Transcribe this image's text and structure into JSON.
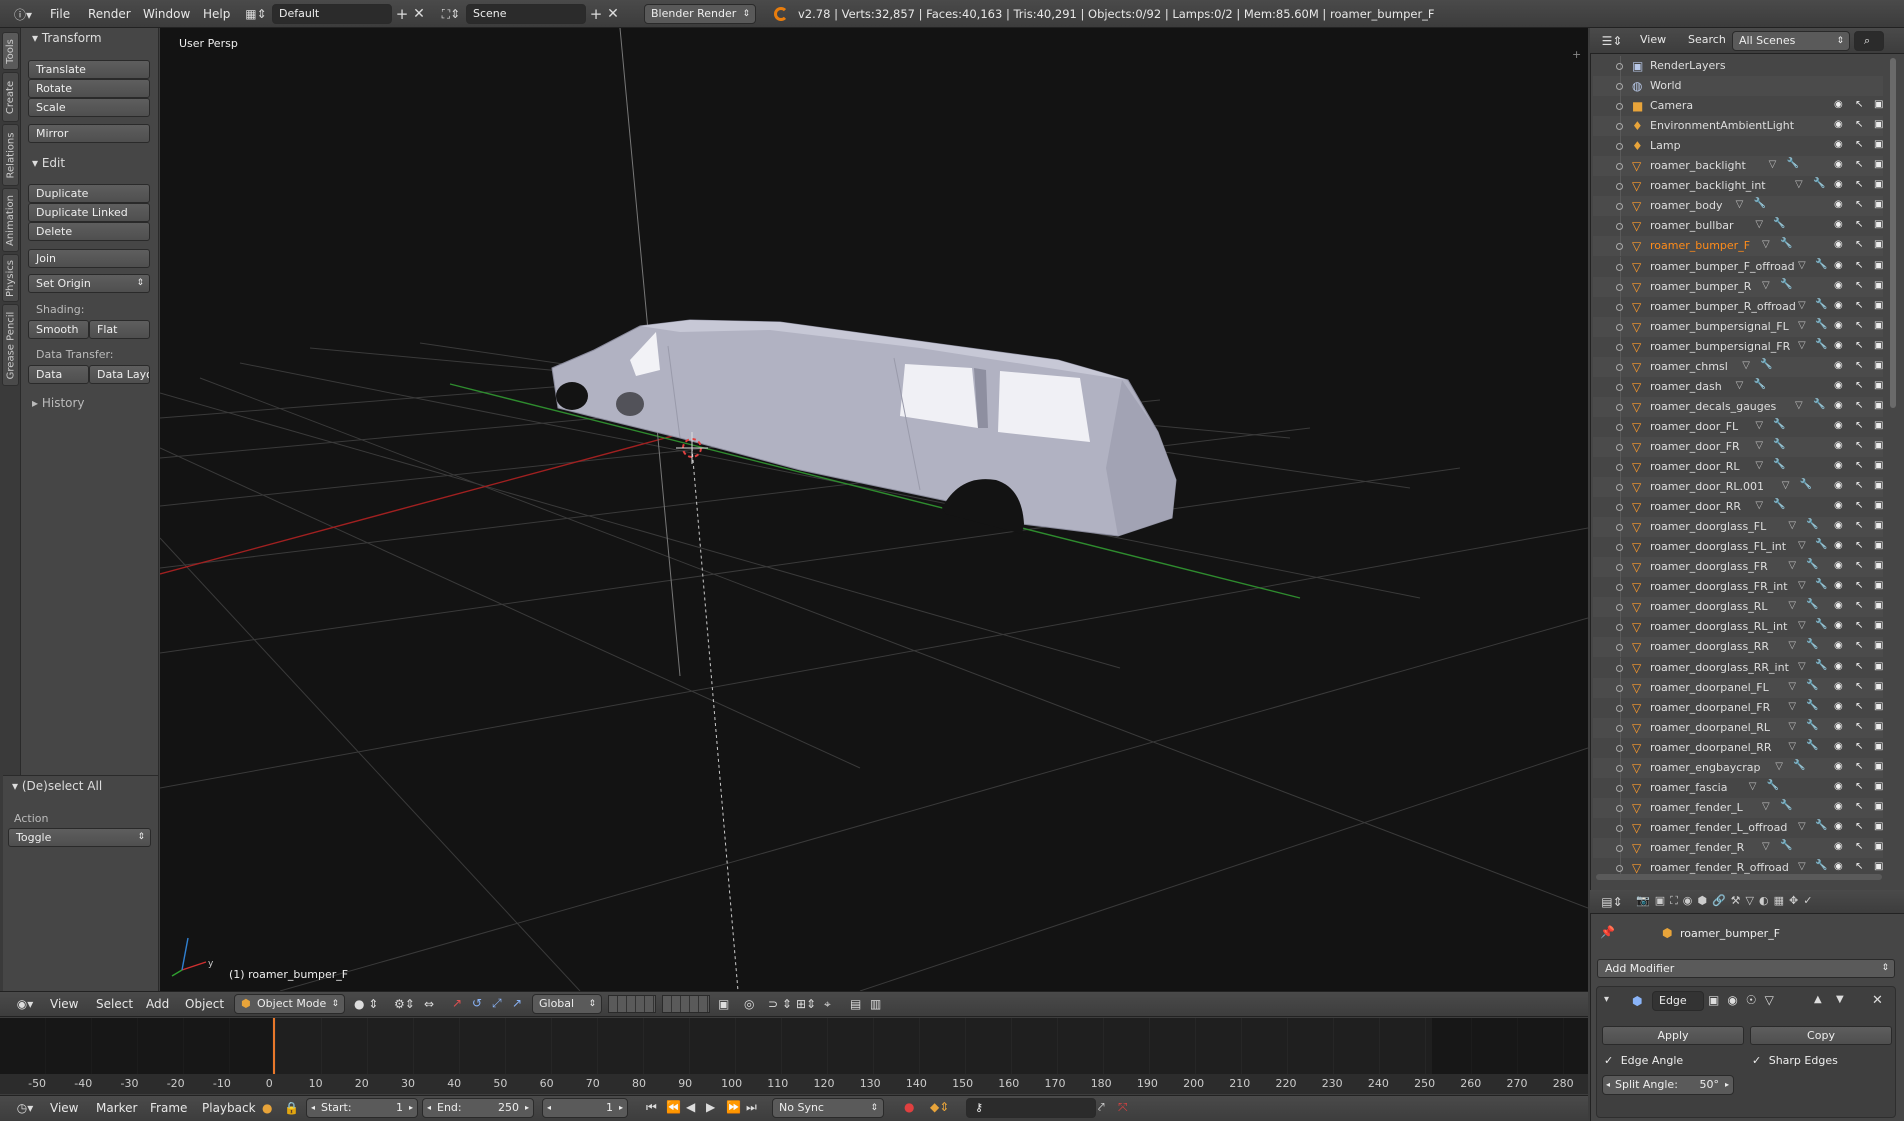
{
  "topbar": {
    "menus": [
      "File",
      "Render",
      "Window",
      "Help"
    ],
    "layout": "Default",
    "scene": "Scene",
    "engine": "Blender Render",
    "stats": "v2.78 | Verts:32,857 | Faces:40,163 | Tris:40,291 | Objects:0/92 | Lamps:0/2 | Mem:85.60M | roamer_bumper_F"
  },
  "vtabs": [
    "Tools",
    "Create",
    "Relations",
    "Animation",
    "Physics",
    "Grease Pencil"
  ],
  "tool_shelf": {
    "transform_title": "Transform",
    "translate": "Translate",
    "rotate": "Rotate",
    "scale": "Scale",
    "mirror": "Mirror",
    "edit_title": "Edit",
    "duplicate": "Duplicate",
    "duplicate_linked": "Duplicate Linked",
    "delete": "Delete",
    "join": "Join",
    "set_origin": "Set Origin",
    "shading_label": "Shading:",
    "smooth": "Smooth",
    "flat": "Flat",
    "data_transfer_label": "Data Transfer:",
    "data": "Data",
    "data_layout": "Data Layo",
    "history_title": "History",
    "operator_title": "(De)select All",
    "action_label": "Action",
    "action_value": "Toggle"
  },
  "viewport": {
    "view_label": "User Persp",
    "object_label": "(1) roamer_bumper_F"
  },
  "view3d_header": {
    "menus": [
      "View",
      "Select",
      "Add",
      "Object"
    ],
    "mode": "Object Mode",
    "orientation": "Global"
  },
  "timeline": {
    "ruler": [
      "-50",
      "-40",
      "-30",
      "-20",
      "-10",
      "0",
      "10",
      "20",
      "30",
      "40",
      "50",
      "60",
      "70",
      "80",
      "90",
      "100",
      "110",
      "120",
      "130",
      "140",
      "150",
      "160",
      "170",
      "180",
      "190",
      "200",
      "210",
      "220",
      "230",
      "240",
      "250",
      "260",
      "270",
      "280"
    ],
    "current_frame_marker": 0,
    "menus": [
      "View",
      "Marker",
      "Frame",
      "Playback"
    ],
    "start_label": "Start:",
    "start": "1",
    "end_label": "End:",
    "end": "250",
    "current": "1",
    "sync": "No Sync"
  },
  "outliner": {
    "header_menus": [
      "View",
      "Search"
    ],
    "scene_filter": "All Scenes",
    "rows": [
      {
        "name": "RenderLayers",
        "icon": "renderlayers-icon"
      },
      {
        "name": "World",
        "icon": "world-icon"
      },
      {
        "name": "Camera",
        "icon": "camera-icon"
      },
      {
        "name": "EnvironmentAmbientLight",
        "icon": "lamp-icon"
      },
      {
        "name": "Lamp",
        "icon": "lamp-icon"
      },
      {
        "name": "roamer_backlight",
        "icon": "mesh-icon"
      },
      {
        "name": "roamer_backlight_int",
        "icon": "mesh-icon"
      },
      {
        "name": "roamer_body",
        "icon": "mesh-icon"
      },
      {
        "name": "roamer_bullbar",
        "icon": "mesh-icon"
      },
      {
        "name": "roamer_bumper_F",
        "icon": "mesh-icon",
        "active": true
      },
      {
        "name": "roamer_bumper_F_offroad",
        "icon": "mesh-icon"
      },
      {
        "name": "roamer_bumper_R",
        "icon": "mesh-icon"
      },
      {
        "name": "roamer_bumper_R_offroad",
        "icon": "mesh-icon"
      },
      {
        "name": "roamer_bumpersignal_FL",
        "icon": "mesh-icon"
      },
      {
        "name": "roamer_bumpersignal_FR",
        "icon": "mesh-icon"
      },
      {
        "name": "roamer_chmsl",
        "icon": "mesh-icon"
      },
      {
        "name": "roamer_dash",
        "icon": "mesh-icon"
      },
      {
        "name": "roamer_decals_gauges",
        "icon": "mesh-icon"
      },
      {
        "name": "roamer_door_FL",
        "icon": "mesh-icon"
      },
      {
        "name": "roamer_door_FR",
        "icon": "mesh-icon"
      },
      {
        "name": "roamer_door_RL",
        "icon": "mesh-icon"
      },
      {
        "name": "roamer_door_RL.001",
        "icon": "mesh-icon"
      },
      {
        "name": "roamer_door_RR",
        "icon": "mesh-icon"
      },
      {
        "name": "roamer_doorglass_FL",
        "icon": "mesh-icon"
      },
      {
        "name": "roamer_doorglass_FL_int",
        "icon": "mesh-icon"
      },
      {
        "name": "roamer_doorglass_FR",
        "icon": "mesh-icon"
      },
      {
        "name": "roamer_doorglass_FR_int",
        "icon": "mesh-icon"
      },
      {
        "name": "roamer_doorglass_RL",
        "icon": "mesh-icon"
      },
      {
        "name": "roamer_doorglass_RL_int",
        "icon": "mesh-icon"
      },
      {
        "name": "roamer_doorglass_RR",
        "icon": "mesh-icon"
      },
      {
        "name": "roamer_doorglass_RR_int",
        "icon": "mesh-icon"
      },
      {
        "name": "roamer_doorpanel_FL",
        "icon": "mesh-icon"
      },
      {
        "name": "roamer_doorpanel_FR",
        "icon": "mesh-icon"
      },
      {
        "name": "roamer_doorpanel_RL",
        "icon": "mesh-icon"
      },
      {
        "name": "roamer_doorpanel_RR",
        "icon": "mesh-icon"
      },
      {
        "name": "roamer_engbaycrap",
        "icon": "mesh-icon"
      },
      {
        "name": "roamer_fascia",
        "icon": "mesh-icon"
      },
      {
        "name": "roamer_fender_L",
        "icon": "mesh-icon"
      },
      {
        "name": "roamer_fender_L_offroad",
        "icon": "mesh-icon"
      },
      {
        "name": "roamer_fender_R",
        "icon": "mesh-icon"
      },
      {
        "name": "roamer_fender_R_offroad",
        "icon": "mesh-icon"
      }
    ]
  },
  "properties": {
    "object": "roamer_bumper_F",
    "add_modifier": "Add Modifier",
    "modifier_name": "Edge",
    "apply": "Apply",
    "copy": "Copy",
    "edge_angle": "Edge Angle",
    "sharp_edges": "Sharp Edges",
    "split_angle_label": "Split Angle:",
    "split_angle": "50°"
  },
  "colors": {
    "active_item": "#ff8c1a",
    "x_axis": "#a02020",
    "y_axis": "#2e8b2e",
    "viewport_bg": "#131313"
  }
}
